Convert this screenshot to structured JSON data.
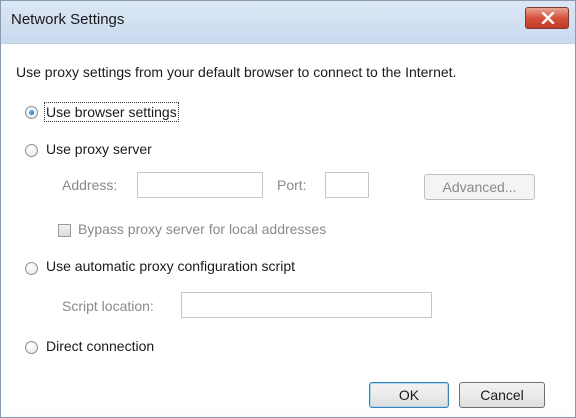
{
  "window": {
    "title": "Network Settings",
    "close_icon": "close-icon"
  },
  "intro_text": "Use proxy settings from your default browser to connect to the Internet.",
  "options": {
    "use_browser_settings": {
      "label": "Use browser settings",
      "selected": true
    },
    "use_proxy_server": {
      "label": "Use proxy server",
      "selected": false
    },
    "automatic_proxy_script": {
      "label": "Use automatic proxy configuration script",
      "selected": false
    },
    "direct_connection": {
      "label": "Direct connection",
      "selected": false
    }
  },
  "proxy": {
    "address_label": "Address:",
    "address_value": "",
    "port_label": "Port:",
    "port_value": "",
    "advanced_button": "Advanced...",
    "bypass_label": "Bypass proxy server for local addresses",
    "bypass_checked": false
  },
  "script": {
    "location_label": "Script location:",
    "location_value": ""
  },
  "buttons": {
    "ok": "OK",
    "cancel": "Cancel"
  }
}
